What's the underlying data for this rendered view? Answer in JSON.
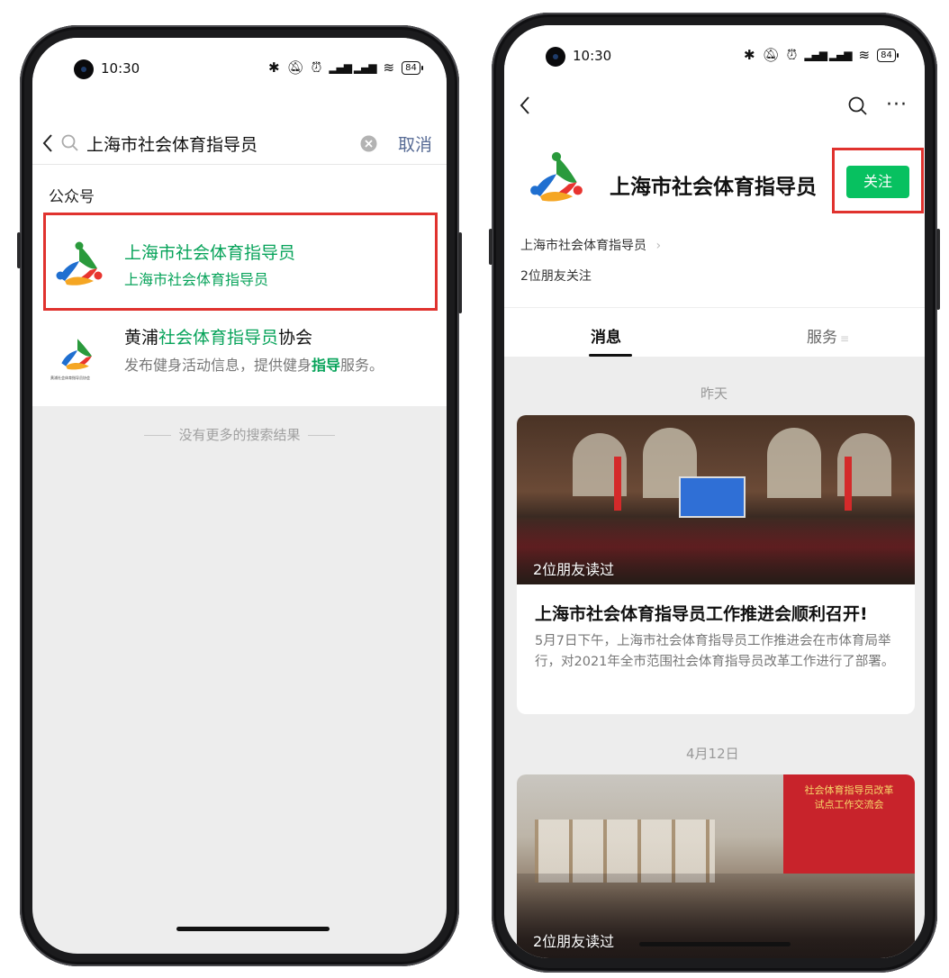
{
  "left_phone": {
    "status": {
      "time": "10:30",
      "battery": "84"
    },
    "search": {
      "query": "上海市社会体育指导员",
      "cancel_label": "取消"
    },
    "section_title": "公众号",
    "results": [
      {
        "title": "上海市社会体育指导员",
        "subtitle": "上海市社会体育指导员"
      },
      {
        "title_parts": [
          "黄浦",
          "社会体育指导员",
          "协会"
        ],
        "desc_parts": [
          "发布健身活动信息，提供健身",
          "指导",
          "服务。"
        ],
        "logo_caption": "黄浦社会体育指导员协会"
      }
    ],
    "no_more_results": "没有更多的搜索结果"
  },
  "right_phone": {
    "status": {
      "time": "10:30",
      "battery": "84"
    },
    "account_name": "上海市社会体育指导员",
    "follow_label": "关注",
    "account_subtitle": "上海市社会体育指导员",
    "friends_following": "2位朋友关注",
    "tabs": [
      {
        "label": "消息"
      },
      {
        "label": "服务"
      }
    ],
    "date_groups": [
      "昨天",
      "4月12日"
    ],
    "articles": [
      {
        "read_by": "2位朋友读过",
        "title": "上海市社会体育指导员工作推进会顺利召开!",
        "summary": "5月7日下午，上海市社会体育指导员工作推进会在市体育局举行，对2021年全市范围社会体育指导员改革工作进行了部署。"
      },
      {
        "read_by": "2位朋友读过",
        "banner": [
          "社会体育指导员改革",
          "试点工作交流会"
        ]
      }
    ]
  },
  "colors": {
    "accent_green": "#07c160",
    "link_green": "#07a35a",
    "highlight_red": "#e0322e",
    "page_bg": "#ededed"
  },
  "icons": [
    "back-icon",
    "search-icon",
    "clear-icon",
    "more-icon",
    "bluetooth-icon",
    "mute-icon",
    "alarm-icon",
    "signal-icon",
    "wifi-icon",
    "battery-icon",
    "chevron-right-icon",
    "menu-icon"
  ]
}
